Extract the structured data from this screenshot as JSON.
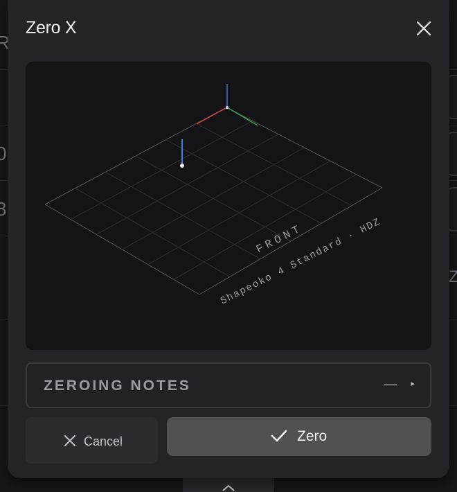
{
  "background": {
    "fragments": [
      "R",
      "0",
      "8",
      "Z"
    ]
  },
  "dialog": {
    "title": "Zero X",
    "close_icon": "close-icon",
    "viewport": {
      "front_label": "FRONT",
      "machine_label": "Shapeoko 4 Standard · HDZ",
      "axis_colors": {
        "x": "#d0443f",
        "y": "#3fa85a",
        "z": "#3f6fd0"
      },
      "tool_color": "#3f7fe6"
    },
    "notes": {
      "label": "ZEROING NOTES",
      "dash": "—",
      "arrow": "▸"
    },
    "cancel_button": {
      "label": "Cancel",
      "icon": "x-icon"
    },
    "zero_button": {
      "label": "Zero",
      "icon": "check-icon"
    }
  },
  "colors": {
    "dialog_bg": "#242428",
    "viewport_bg": "#141416",
    "primary_button": "#505055"
  }
}
